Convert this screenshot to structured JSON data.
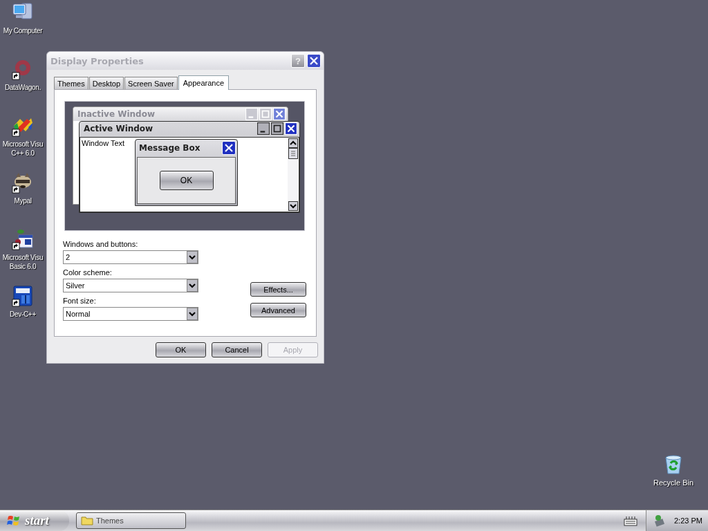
{
  "desktop_icons": [
    {
      "kind": "computer",
      "shortcut": false,
      "lines": [
        "My Computer"
      ]
    },
    {
      "kind": "gear",
      "shortcut": true,
      "lines": [
        "DataWagon."
      ]
    },
    {
      "kind": "ribbon",
      "shortcut": true,
      "lines": [
        "Microsoft Visu",
        "C++ 6.0"
      ]
    },
    {
      "kind": "animal",
      "shortcut": true,
      "lines": [
        "Mypal"
      ]
    },
    {
      "kind": "plant",
      "shortcut": true,
      "lines": [
        "Microsoft Visu",
        "Basic 6.0"
      ]
    },
    {
      "kind": "blue-box",
      "shortcut": true,
      "lines": [
        "Dev-C++"
      ]
    }
  ],
  "recycle_bin": {
    "label": "Recycle Bin"
  },
  "dialog": {
    "title": "Display Properties",
    "help": "?",
    "tabs": [
      {
        "label": "Themes",
        "selected": false
      },
      {
        "label": "Desktop",
        "selected": false
      },
      {
        "label": "Screen Saver",
        "selected": false
      },
      {
        "label": "Appearance",
        "selected": true
      }
    ],
    "preview": {
      "inactive_title": "Inactive Window",
      "active_title": "Active Window",
      "window_text": "Window Text",
      "message_title": "Message Box",
      "message_button": "OK"
    },
    "fields": [
      {
        "label": "Windows and buttons:",
        "value": "2"
      },
      {
        "label": "Color scheme:",
        "value": "Silver"
      },
      {
        "label": "Font size:",
        "value": "Normal"
      }
    ],
    "side_buttons": [
      "Effects...",
      "Advanced"
    ],
    "footer_buttons": [
      {
        "label": "OK",
        "disabled": false
      },
      {
        "label": "Cancel",
        "disabled": false
      },
      {
        "label": "Apply",
        "disabled": true
      }
    ]
  },
  "taskbar": {
    "start": "start",
    "tasks": [
      {
        "label": "Themes"
      }
    ],
    "clock": "2:23 PM"
  }
}
